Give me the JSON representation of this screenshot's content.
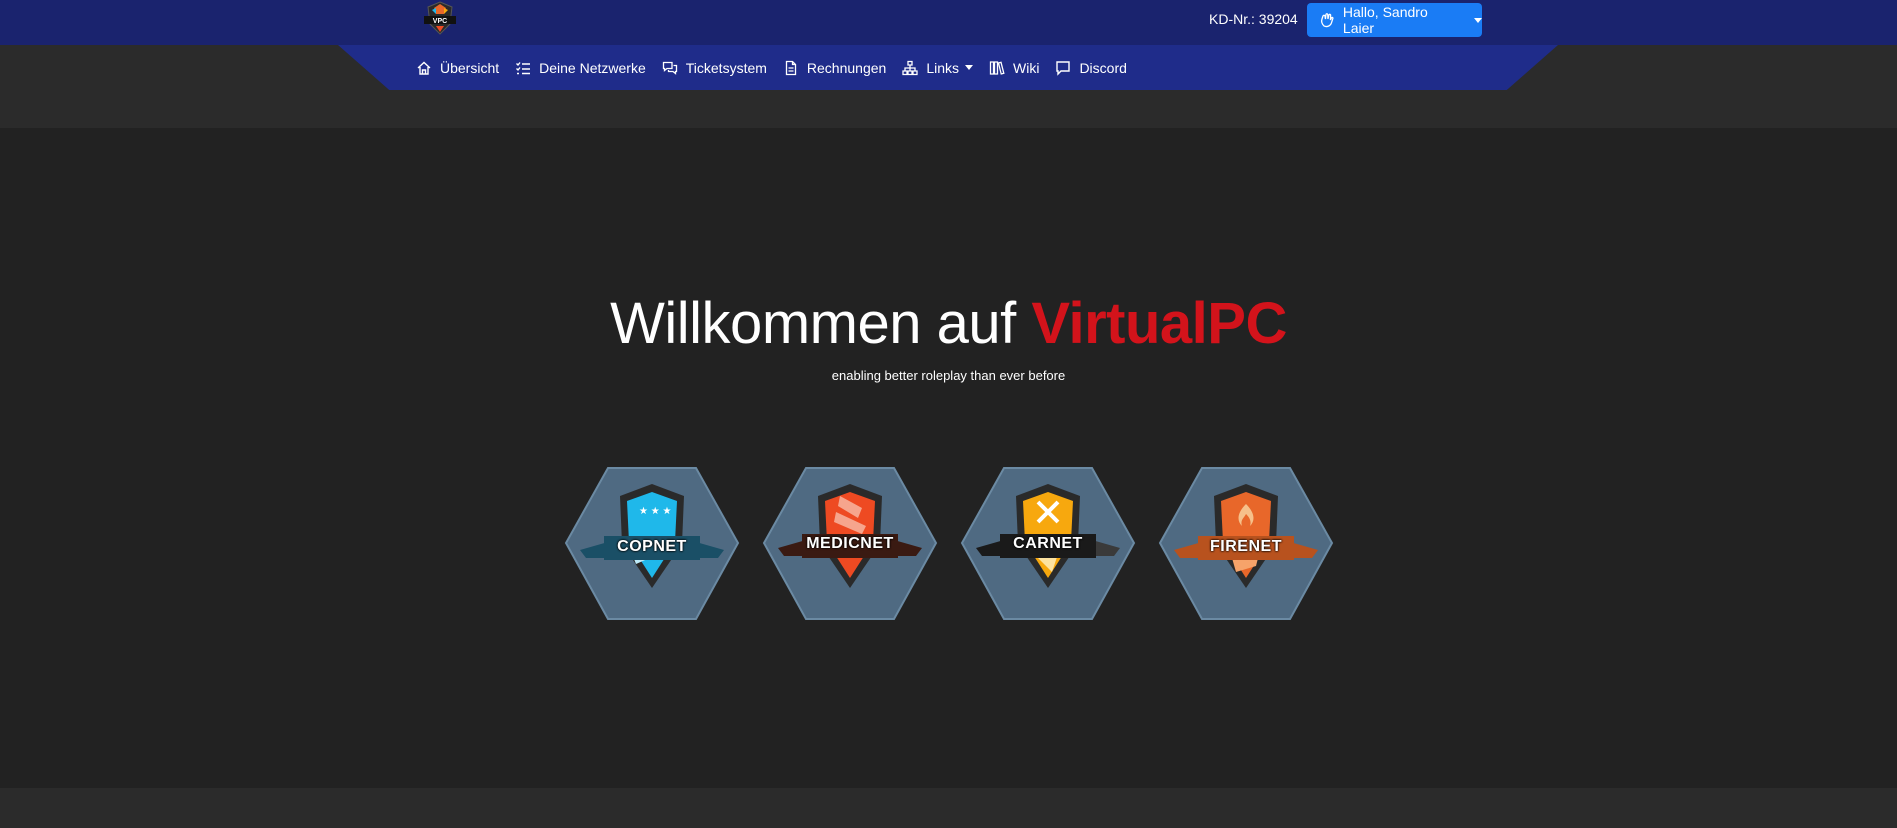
{
  "header": {
    "logo_text": "VPC",
    "customer_number": "KD-Nr.: 39204",
    "user_greeting": "Hallo, Sandro Laier"
  },
  "nav": {
    "items": [
      {
        "label": "Übersicht",
        "icon": "home-icon"
      },
      {
        "label": "Deine Netzwerke",
        "icon": "list-check-icon"
      },
      {
        "label": "Ticketsystem",
        "icon": "chat-icon"
      },
      {
        "label": "Rechnungen",
        "icon": "invoice-icon"
      },
      {
        "label": "Links",
        "icon": "sitemap-icon",
        "dropdown": true
      },
      {
        "label": "Wiki",
        "icon": "books-icon"
      },
      {
        "label": "Discord",
        "icon": "message-icon"
      }
    ]
  },
  "hero": {
    "title_prefix": "Willkommen auf",
    "title_brand": "VirtualPC",
    "subtitle": "enabling better roleplay than ever before"
  },
  "networks": [
    {
      "name": "COPNET",
      "color": "#1fb8ea",
      "ribbon": "#1a4f66"
    },
    {
      "name": "MEDICNET",
      "color": "#ee4a22",
      "ribbon": "#3a1a12"
    },
    {
      "name": "CARNET",
      "color": "#f7a80e",
      "ribbon": "#2b2b2b"
    },
    {
      "name": "FIRENET",
      "color": "#e8672a",
      "ribbon": "#b8521e"
    }
  ],
  "colors": {
    "topbar": "#1a236e",
    "navbar": "#1f2c8a",
    "button": "#1a7cf5",
    "brand_red": "#d3131b",
    "hex_fill": "#4f6a82"
  }
}
